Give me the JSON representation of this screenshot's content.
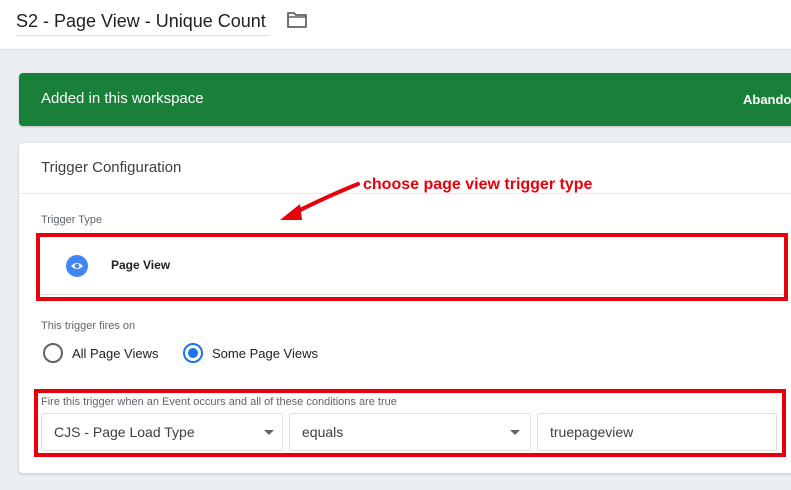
{
  "header": {
    "title": "S2 - Page View - Unique Count",
    "folder_icon": "folder-icon"
  },
  "banner": {
    "text": "Added in this workspace",
    "action": "Abando",
    "color": "#188038"
  },
  "card": {
    "title": "Trigger Configuration",
    "trigger_type_label": "Trigger Type",
    "trigger_type": {
      "name": "Page View",
      "icon": "eye-icon",
      "icon_color": "#4285f4"
    },
    "fires_on_label": "This trigger fires on",
    "fires_on_options": [
      {
        "label": "All Page Views",
        "selected": false
      },
      {
        "label": "Some Page Views",
        "selected": true
      }
    ],
    "conditions_label": "Fire this trigger when an Event occurs and all of these conditions are true",
    "condition": {
      "variable": "CJS - Page Load Type",
      "operator": "equals",
      "value": "truepageview"
    }
  },
  "annotation": {
    "text": "choose page view trigger type",
    "color": "#e8000b"
  }
}
